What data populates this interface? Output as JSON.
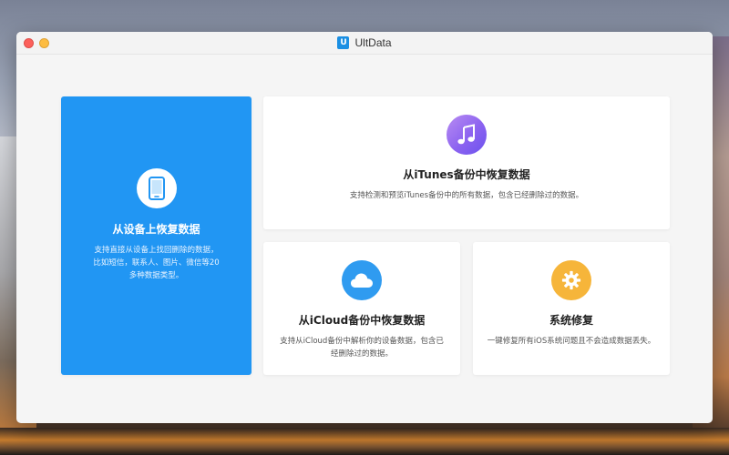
{
  "window": {
    "app_title": "UltData",
    "logo_letter": "U"
  },
  "cards": {
    "device": {
      "title": "从设备上恢复数据",
      "desc": "支持直接从设备上找回删除的数据，比如短信，联系人、图片、微信等20多种数据类型。",
      "icon": "phone-icon",
      "color": "#2196f3"
    },
    "itunes": {
      "title": "从iTunes备份中恢复数据",
      "desc": "支持检测和预览iTunes备份中的所有数据，包含已经删除过的数据。",
      "icon": "music-note-icon"
    },
    "icloud": {
      "title": "从iCloud备份中恢复数据",
      "desc": "支持从iCloud备份中解析你的设备数据，包含已经删除过的数据。",
      "icon": "cloud-icon",
      "color": "#2f9bf0"
    },
    "repair": {
      "title": "系统修复",
      "desc": "一键修复所有iOS系统问题且不会造成数据丢失。",
      "icon": "gear-icon",
      "color": "#f6b53a"
    }
  }
}
